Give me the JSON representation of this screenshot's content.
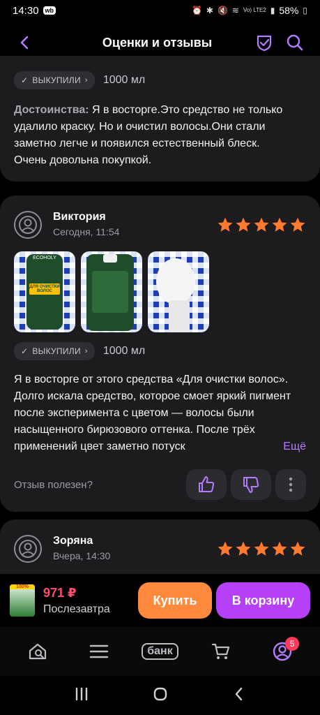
{
  "status_bar": {
    "time": "14:30",
    "app_badge": "wb",
    "network": "Vo) LTE2",
    "battery": "58%"
  },
  "header": {
    "title": "Оценки и отзывы"
  },
  "review1": {
    "bought_label": "ВЫКУПИЛИ",
    "volume": "1000 мл",
    "advantages_label": "Достоинства:",
    "text": "Я в восторге.Это средство не только удалило краску. Но и очистил волосы.Они стали заметно легче и появился естественный блеск. Очень довольна покупкой."
  },
  "review2": {
    "author": "Виктория",
    "date": "Сегодня, 11:54",
    "rating": 5,
    "bottle_label": "ДЛЯ ОЧИСТКИ ВОЛОС",
    "brand": "ECOHOLY",
    "bought_label": "ВЫКУПИЛИ",
    "volume": "1000 мл",
    "text": "Я в восторге от этого средства «Для очистки волос». Долго искала средство, которое смоет яркий пигмент после эксперимента с цветом — волосы были насыщенного бирюзового оттенка. После трёх применений цвет заметно потуск",
    "more_label": "Ещё",
    "helpful_label": "Отзыв полезен?"
  },
  "review3": {
    "author": "Зоряна",
    "date": "Вчера, 14:30",
    "rating": 5
  },
  "buy_bar": {
    "thumb_badge": "100%",
    "price": "971 ₽",
    "delivery": "Послезавтра",
    "buy_label": "Купить",
    "cart_label": "В корзину"
  },
  "tab_bar": {
    "bank_label": "банк",
    "profile_badge": "5"
  },
  "colors": {
    "accent": "#b640f5",
    "star": "#ff7a2f",
    "buy": "#ff8a3d",
    "price": "#ff4d6d",
    "card": "#1c1c1e"
  }
}
